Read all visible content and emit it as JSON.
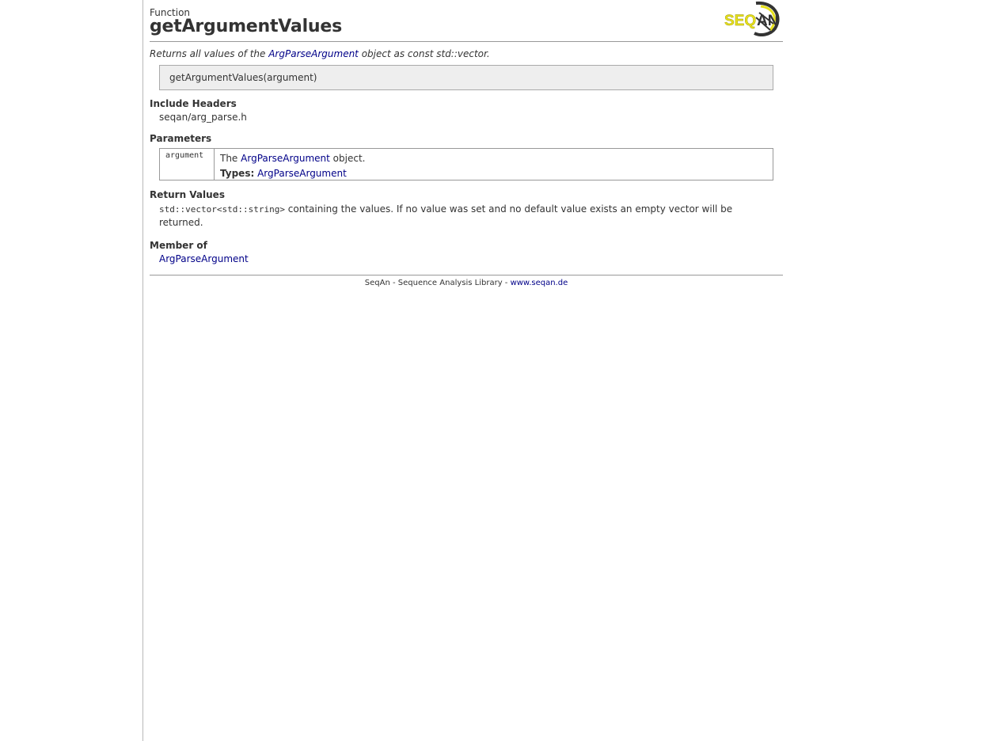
{
  "header": {
    "kind": "Function",
    "title": "getArgumentValues",
    "logo_text": "SEQAN"
  },
  "summary": {
    "prefix": "Returns all values of the ",
    "link": "ArgParseArgument",
    "suffix": " object as const std::vector."
  },
  "signature": "getArgumentValues(argument)",
  "include_headers": {
    "title": "Include Headers",
    "items": [
      "seqan/arg_parse.h"
    ]
  },
  "parameters": {
    "title": "Parameters",
    "rows": [
      {
        "name": "argument",
        "desc_prefix": "The ",
        "desc_link": "ArgParseArgument",
        "desc_suffix": " object.",
        "types_label": "Types:",
        "types_link": "ArgParseArgument"
      }
    ]
  },
  "return_values": {
    "title": "Return Values",
    "code": "std::vector<std::string>",
    "text": " containing the values. If no value was set and no default value exists an empty vector will be returned."
  },
  "member_of": {
    "title": "Member of",
    "link": "ArgParseArgument"
  },
  "footer": {
    "text": "SeqAn - Sequence Analysis Library - ",
    "link": "www.seqan.de"
  },
  "colors": {
    "link": "#000088",
    "signature_bg": "#eeeeee",
    "logo_yellow": "#e6e01c"
  }
}
